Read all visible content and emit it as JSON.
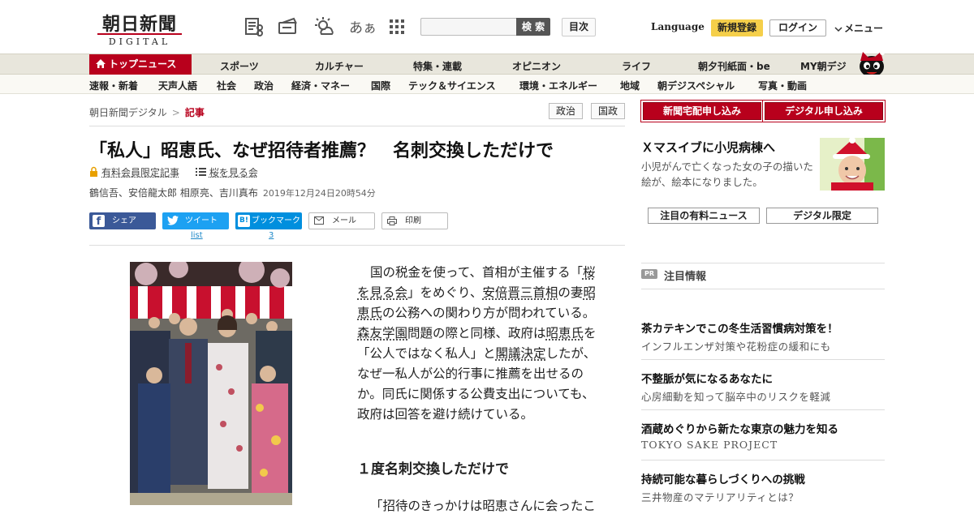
{
  "header": {
    "logo_jp": "朝日新聞",
    "logo_en": "DIGITAL",
    "font_size_label": "あぁ",
    "search_button": "検 索",
    "toc_button": "目次",
    "language": "Language",
    "register": "新規登録",
    "login": "ログイン",
    "menu": "メニュー"
  },
  "nav_main": [
    "トップニュース",
    "スポーツ",
    "カルチャー",
    "特集・連載",
    "オピニオン",
    "ライフ",
    "朝夕刊紙面・be",
    "MY朝デジ"
  ],
  "nav_sub": [
    "速報・新着",
    "天声人語",
    "社会",
    "政治",
    "経済・マネー",
    "国際",
    "テック＆サイエンス",
    "環境・エネルギー",
    "地域",
    "朝デジスペシャル",
    "写真・動画"
  ],
  "breadcrumb": {
    "home": "朝日新聞デジタル",
    "sep": ">",
    "current": "記事"
  },
  "tags": [
    "政治",
    "国政"
  ],
  "article": {
    "title": "「私人」昭恵氏、なぜ招待者推薦？　名刺交換しただけで",
    "members_only": "有料会員限定記事",
    "topic": "桜を見る会",
    "authors": "鶴信吾、安倍龍太郎 相原亮、吉川真布",
    "date": "2019年12月24日20時54分",
    "body": [
      "国の税金を使って、首相が主催する「",
      "桜を見る会",
      "」をめぐり、",
      "安倍晋三首相",
      "の妻",
      "昭恵氏",
      "の公務への関わり方が問われている。",
      "森友学園",
      "問題の際と同様、政府は",
      "昭恵氏",
      "を「公人ではなく私人」と",
      "閣議決定",
      "したが、なぜ一私人が公的行事に推薦を出せるのか。同氏に関係する公費支出についても、政府は回答を避け続けている。"
    ],
    "subheading": "１度名刺交換しただけで",
    "quote_start": "「招待のきっかけは昭恵さんに会ったこ"
  },
  "share": {
    "facebook": "シェア",
    "twitter": "ツイート",
    "hatena": "ブックマーク",
    "mail": "メール",
    "print": "印刷",
    "twitter_count": "list",
    "hatena_count": "3"
  },
  "sidebar": {
    "btn_paper": "新聞宅配申し込み",
    "btn_digital": "デジタル申し込み",
    "promo_title": "Ｘマスイブに小児病棟へ",
    "promo_desc": "小児がんで亡くなった女の子の描いた絵が、絵本になりました。",
    "tab1": "注目の有料ニュース",
    "tab2": "デジタル限定",
    "pr_badge": "PR",
    "pr_heading": "注目情報",
    "pr_items": [
      {
        "title": "茶カテキンでこの冬生活習慣病対策を！",
        "sub": "インフルエンザ対策や花粉症の緩和にも"
      },
      {
        "title": "不整脈が気になるあなたに",
        "sub": "心房細動を知って脳卒中のリスクを軽減"
      },
      {
        "title": "酒蔵めぐりから新たな東京の魅力を知る",
        "sub": "TOKYO SAKE PROJECT"
      },
      {
        "title": "持続可能な暮らしづくりへの挑戦",
        "sub": "三井物産のマテリアリティとは？"
      }
    ]
  },
  "colors": {
    "brand_red": "#b8001c",
    "facebook": "#3b5998",
    "twitter": "#1da1f2",
    "hatena": "#008fde",
    "register_yellow": "#f5cf4a"
  }
}
